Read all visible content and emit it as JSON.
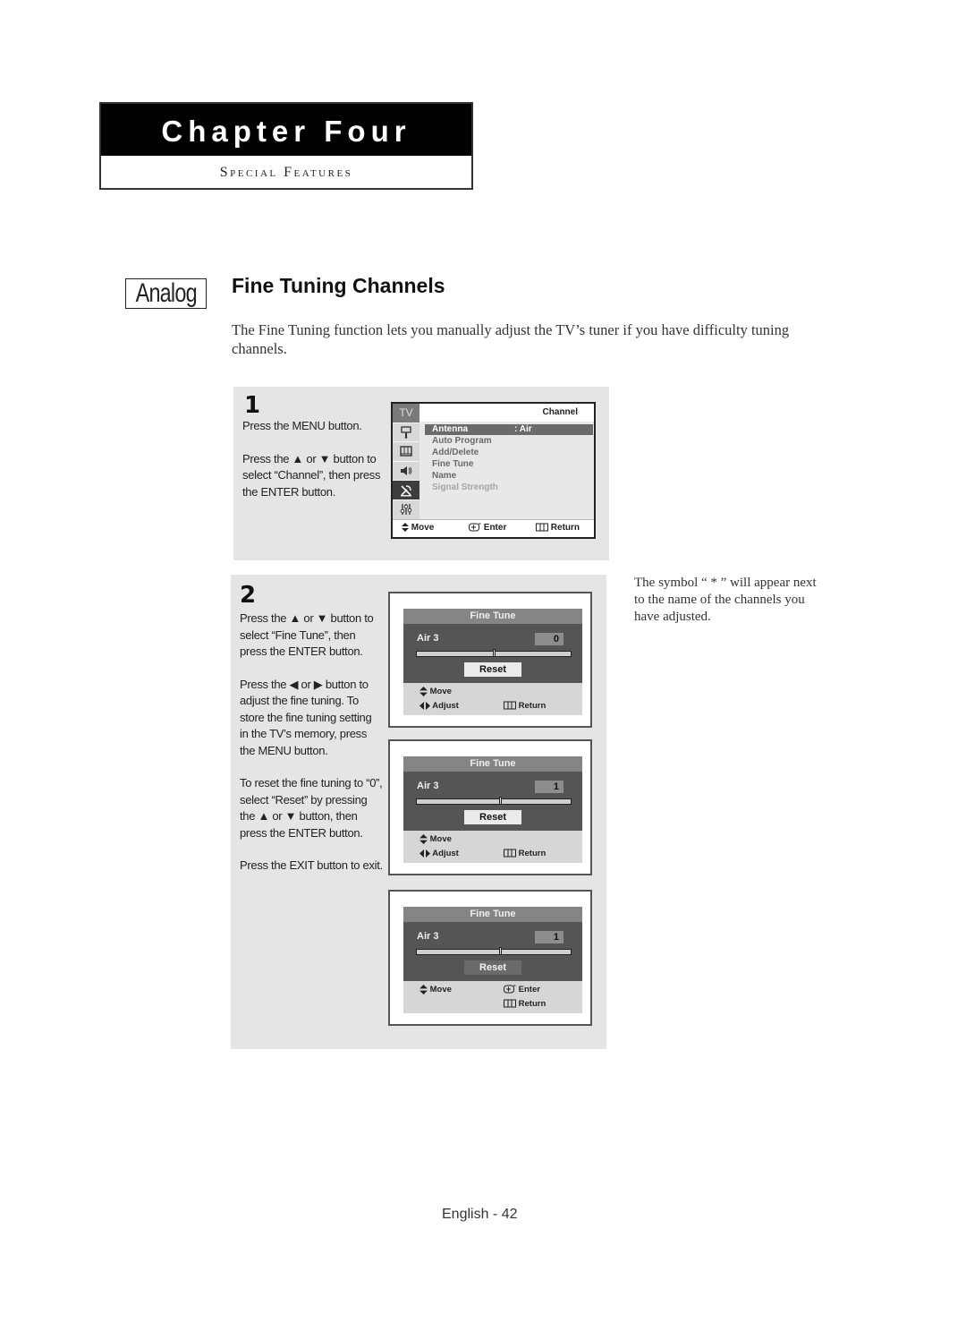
{
  "chapter": {
    "title": "Chapter Four",
    "subtitle": "Special Features"
  },
  "section": {
    "badge": "Analog",
    "title": "Fine Tuning Channels",
    "intro": "The Fine Tuning function lets you manually adjust the TV’s tuner if you have difficulty tuning channels."
  },
  "step1": {
    "number": "1",
    "paragraphs": [
      "Press the MENU button.",
      "Press the ▲ or ▼ button to select “Channel”, then press the ENTER button."
    ],
    "screen": {
      "side_tabs": [
        {
          "label": "TV",
          "icon": "tv-label"
        },
        {
          "icon": "input-icon"
        },
        {
          "icon": "picture-icon"
        },
        {
          "icon": "sound-icon"
        },
        {
          "icon": "channel-antenna-icon",
          "active": true
        },
        {
          "icon": "setup-sliders-icon"
        }
      ],
      "header": "Channel",
      "items": [
        {
          "label": "Antenna",
          "value": ":  Air",
          "selected": true
        },
        {
          "label": "Auto Program"
        },
        {
          "label": "Add/Delete"
        },
        {
          "label": "Fine Tune"
        },
        {
          "label": "Name"
        },
        {
          "label": "Signal Strength",
          "disabled": true
        }
      ],
      "footer": {
        "move": "Move",
        "enter": "Enter",
        "return": "Return"
      }
    }
  },
  "step2": {
    "number": "2",
    "paragraphs": [
      "Press the ▲ or ▼ button to select “Fine Tune”, then press the ENTER button.",
      "Press the ◀ or ▶ button to adjust the fine tuning. To store the fine tuning setting in the TV’s memory, press the MENU button.",
      "To reset the fine tuning to “0”, select “Reset” by pressing the ▲ or ▼ button, then press the ENTER button.",
      "Press the EXIT button to exit."
    ],
    "screens": [
      {
        "title": "Fine Tune",
        "channel": "Air 3",
        "value": "0",
        "slider_fraction": 0.5,
        "reset": "Reset",
        "reset_focused": false,
        "footer": {
          "move": "Move",
          "adjust": "Adjust",
          "return": "Return"
        }
      },
      {
        "title": "Fine Tune",
        "channel": "Air 3",
        "value": "1",
        "slider_fraction": 0.54,
        "reset": "Reset",
        "reset_focused": false,
        "footer": {
          "move": "Move",
          "adjust": "Adjust",
          "return": "Return"
        }
      },
      {
        "title": "Fine Tune",
        "channel": "Air 3",
        "value": "1",
        "slider_fraction": 0.54,
        "reset": "Reset",
        "reset_focused": true,
        "footer": {
          "move": "Move",
          "enter": "Enter",
          "return": "Return"
        }
      }
    ]
  },
  "note": "The symbol “ * ” will appear next to the name of the channels you have adjusted.",
  "footer": {
    "page": "English - 42"
  }
}
